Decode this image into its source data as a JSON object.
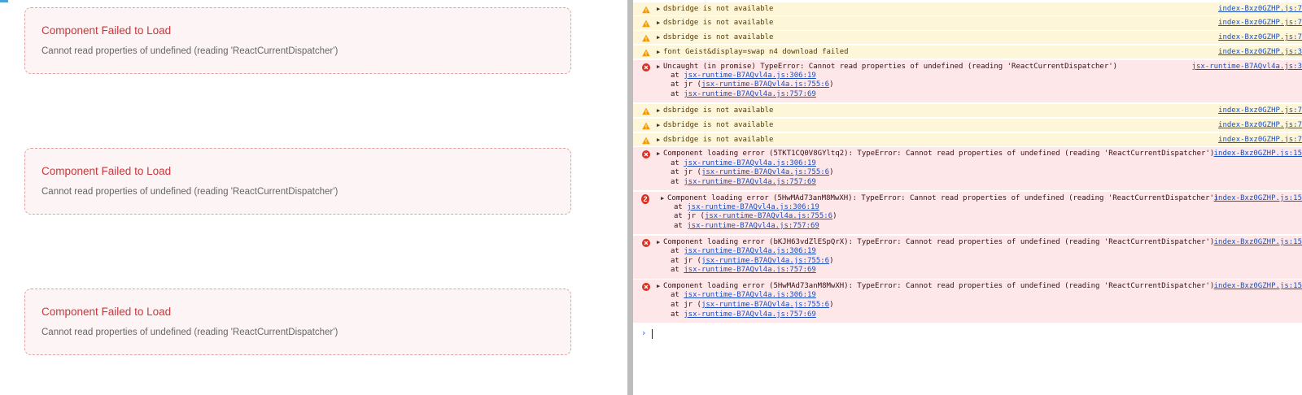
{
  "app": {
    "cards": [
      {
        "title": "Component Failed to Load",
        "message": "Cannot read properties of undefined (reading 'ReactCurrentDispatcher')"
      },
      {
        "title": "Component Failed to Load",
        "message": "Cannot read properties of undefined (reading 'ReactCurrentDispatcher')"
      },
      {
        "title": "Component Failed to Load",
        "message": "Cannot read properties of undefined (reading 'ReactCurrentDispatcher')"
      }
    ]
  },
  "console": {
    "colors": {
      "warn_bg": "#fdf6d8",
      "error_bg": "#fde7e9",
      "link": "#1a4fc0",
      "error_icon": "#d93025",
      "warn_icon": "#f29900"
    },
    "messages": [
      {
        "level": "warning",
        "text": "dsbridge is not available",
        "source": "index-Bxz0GZHP.js:7"
      },
      {
        "level": "warning",
        "text": "dsbridge is not available",
        "source": "index-Bxz0GZHP.js:7"
      },
      {
        "level": "warning",
        "text": "dsbridge is not available",
        "source": "index-Bxz0GZHP.js:7"
      },
      {
        "level": "warning",
        "text": "font Geist&display=swap n4 download failed",
        "source": "index-Bxz0GZHP.js:3"
      },
      {
        "level": "error",
        "text": "Uncaught (in promise) TypeError: Cannot read properties of undefined (reading 'ReactCurrentDispatcher')",
        "source": "jsx-runtime-B7AQvl4a.js:3",
        "stack": [
          {
            "prefix": "at ",
            "link": "jsx-runtime-B7AQvl4a.js:306:19",
            "suffix": ""
          },
          {
            "prefix": "at jr (",
            "link": "jsx-runtime-B7AQvl4a.js:755:6",
            "suffix": ")"
          },
          {
            "prefix": "at ",
            "link": "jsx-runtime-B7AQvl4a.js:757:69",
            "suffix": ""
          }
        ]
      },
      {
        "level": "warning",
        "text": "dsbridge is not available",
        "source": "index-Bxz0GZHP.js:7"
      },
      {
        "level": "warning",
        "text": "dsbridge is not available",
        "source": "index-Bxz0GZHP.js:7"
      },
      {
        "level": "warning",
        "text": "dsbridge is not available",
        "source": "index-Bxz0GZHP.js:7"
      },
      {
        "level": "error",
        "text": "Component loading error (5TKT1CQ0V8GYltq2): TypeError: Cannot read properties of undefined (reading 'ReactCurrentDispatcher')",
        "source": "index-Bxz0GZHP.js:15",
        "stack": [
          {
            "prefix": "at ",
            "link": "jsx-runtime-B7AQvl4a.js:306:19",
            "suffix": ""
          },
          {
            "prefix": "at jr (",
            "link": "jsx-runtime-B7AQvl4a.js:755:6",
            "suffix": ")"
          },
          {
            "prefix": "at ",
            "link": "jsx-runtime-B7AQvl4a.js:757:69",
            "suffix": ""
          }
        ]
      },
      {
        "level": "error",
        "count": "2",
        "text": "Component loading error (5HwMAd73anM8MwXH): TypeError: Cannot read properties of undefined (reading 'ReactCurrentDispatcher')",
        "source": "index-Bxz0GZHP.js:15",
        "stack": [
          {
            "prefix": "at ",
            "link": "jsx-runtime-B7AQvl4a.js:306:19",
            "suffix": ""
          },
          {
            "prefix": "at jr (",
            "link": "jsx-runtime-B7AQvl4a.js:755:6",
            "suffix": ")"
          },
          {
            "prefix": "at ",
            "link": "jsx-runtime-B7AQvl4a.js:757:69",
            "suffix": ""
          }
        ]
      },
      {
        "level": "error",
        "text": "Component loading error (bKJH63vdZlESpQrX): TypeError: Cannot read properties of undefined (reading 'ReactCurrentDispatcher')",
        "source": "index-Bxz0GZHP.js:15",
        "stack": [
          {
            "prefix": "at ",
            "link": "jsx-runtime-B7AQvl4a.js:306:19",
            "suffix": ""
          },
          {
            "prefix": "at jr (",
            "link": "jsx-runtime-B7AQvl4a.js:755:6",
            "suffix": ")"
          },
          {
            "prefix": "at ",
            "link": "jsx-runtime-B7AQvl4a.js:757:69",
            "suffix": ""
          }
        ]
      },
      {
        "level": "error",
        "text": "Component loading error (5HwMAd73anM8MwXH): TypeError: Cannot read properties of undefined (reading 'ReactCurrentDispatcher')",
        "source": "index-Bxz0GZHP.js:15",
        "stack": [
          {
            "prefix": "at ",
            "link": "jsx-runtime-B7AQvl4a.js:306:19",
            "suffix": ""
          },
          {
            "prefix": "at jr (",
            "link": "jsx-runtime-B7AQvl4a.js:755:6",
            "suffix": ")"
          },
          {
            "prefix": "at ",
            "link": "jsx-runtime-B7AQvl4a.js:757:69",
            "suffix": ""
          }
        ]
      }
    ],
    "prompt_icon": "chevron-right-icon"
  }
}
